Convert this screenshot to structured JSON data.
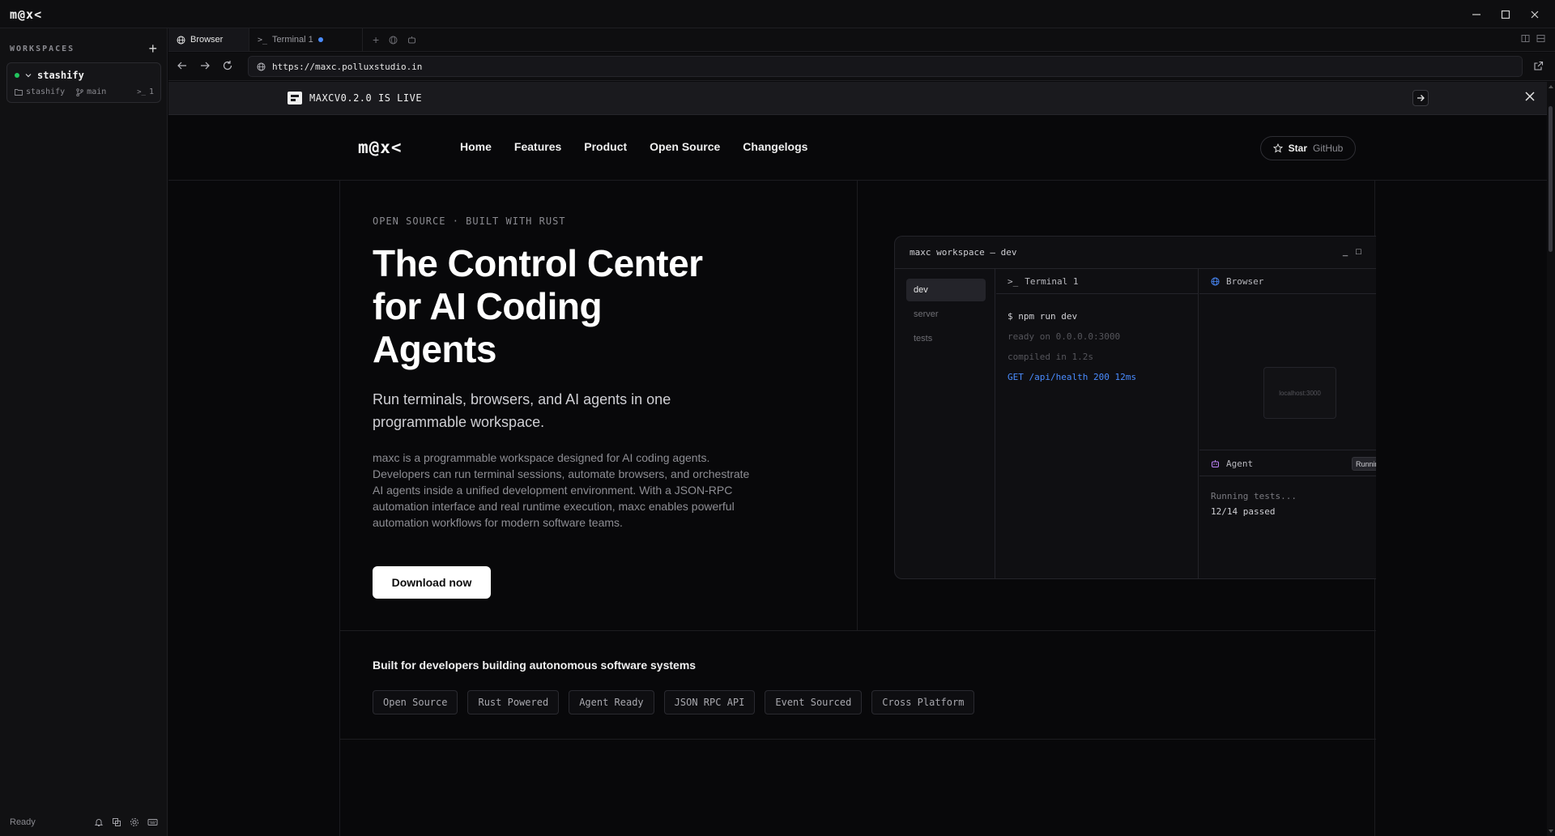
{
  "app": {
    "logo": "m@x<"
  },
  "sidebar": {
    "title": "WORKSPACES",
    "add": "+",
    "workspace": {
      "name": "stashify",
      "folder": "stashify",
      "branch": "main",
      "terminals": "1"
    },
    "status": "Ready"
  },
  "tabs": [
    {
      "label": "Browser",
      "active": true
    },
    {
      "label": "Terminal 1",
      "active": false,
      "unsaved": true
    }
  ],
  "url": "https://maxc.polluxstudio.in",
  "banner": {
    "text": "MAXCV0.2.0 IS LIVE"
  },
  "site": {
    "logo": "m@x<",
    "nav": [
      "Home",
      "Features",
      "Product",
      "Open Source",
      "Changelogs"
    ],
    "star_label": "Star",
    "star_sub": "GitHub"
  },
  "hero": {
    "eyebrow": "OPEN SOURCE · BUILT WITH RUST",
    "title": "The Control Center for AI Coding Agents",
    "subtitle": "Run terminals, browsers, and AI agents in one programmable workspace.",
    "description": "maxc is a programmable workspace designed for AI coding agents. Developers can run terminal sessions, automate browsers, and orchestrate AI agents inside a unified development environment. With a JSON-RPC automation interface and real runtime execution, maxc enables powerful automation workflows for modern software teams.",
    "cta": "Download now"
  },
  "mock": {
    "title": "maxc workspace — dev",
    "min": "_",
    "max": "□",
    "sidebar": [
      "dev",
      "server",
      "tests"
    ],
    "terminal_title": "Terminal 1",
    "terminal_lines": {
      "cmd": "$ npm run dev",
      "l1": "ready on 0.0.0.0:3000",
      "l2": "compiled in 1.2s",
      "l3": "GET /api/health 200 12ms"
    },
    "browser_title": "Browser",
    "browser_url": "localhost:3000",
    "agent_title": "Agent",
    "agent_badge": "Running",
    "agent_lines": {
      "l1": "Running tests...",
      "l2": "12/14 passed"
    }
  },
  "built": {
    "title": "Built for developers building autonomous software systems",
    "chips": [
      "Open Source",
      "Rust Powered",
      "Agent Ready",
      "JSON RPC API",
      "Event Sourced",
      "Cross Platform"
    ]
  },
  "colors": {
    "accent_green": "#22c55e",
    "accent_blue": "#4a8cff",
    "background": "#08080a"
  },
  "icons": [
    "minimize-icon",
    "maximize-icon",
    "close-icon",
    "plus-icon",
    "chevron-down-icon",
    "folder-icon",
    "branch-icon",
    "terminal-icon",
    "globe-icon",
    "back-arrow-icon",
    "forward-arrow-icon",
    "reload-icon",
    "external-link-icon",
    "star-icon",
    "bell-icon",
    "settings-icon"
  ]
}
